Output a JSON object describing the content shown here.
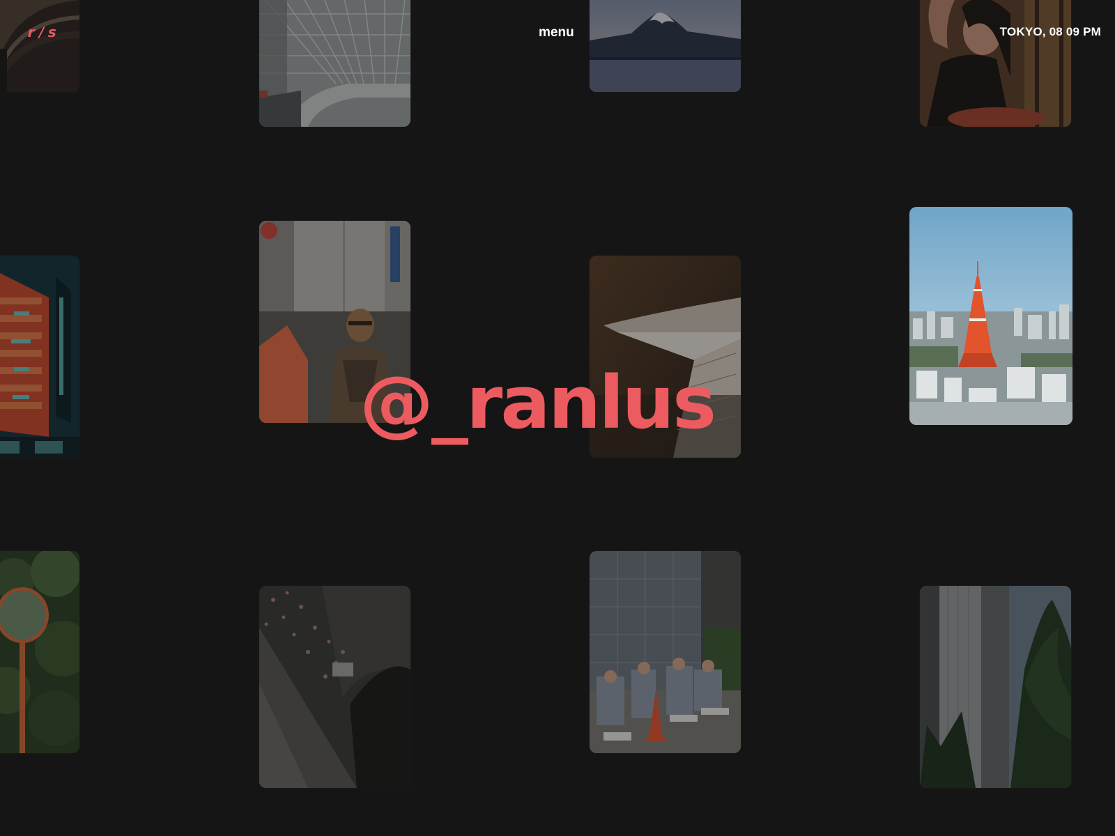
{
  "header": {
    "logo_text": "r/s",
    "menu_label": "menu",
    "location_time": "TOKYO, 08 09 PM"
  },
  "hero": {
    "handle": "@_ranlus"
  },
  "colors": {
    "background": "#151515",
    "accent": "#ec5b5f",
    "text": "#ffffff"
  },
  "gallery": {
    "photos": [
      {
        "name": "photo-arch-interior"
      },
      {
        "name": "photo-glass-atrium"
      },
      {
        "name": "photo-mount-fuji"
      },
      {
        "name": "photo-portrait-woman"
      },
      {
        "name": "photo-neon-sign"
      },
      {
        "name": "photo-street-tattooed-man"
      },
      {
        "name": "photo-curved-interior"
      },
      {
        "name": "photo-tokyo-tower"
      },
      {
        "name": "photo-road-mirror"
      },
      {
        "name": "photo-petals-pavement"
      },
      {
        "name": "photo-seated-workers"
      },
      {
        "name": "photo-skyscraper-trees"
      }
    ]
  }
}
